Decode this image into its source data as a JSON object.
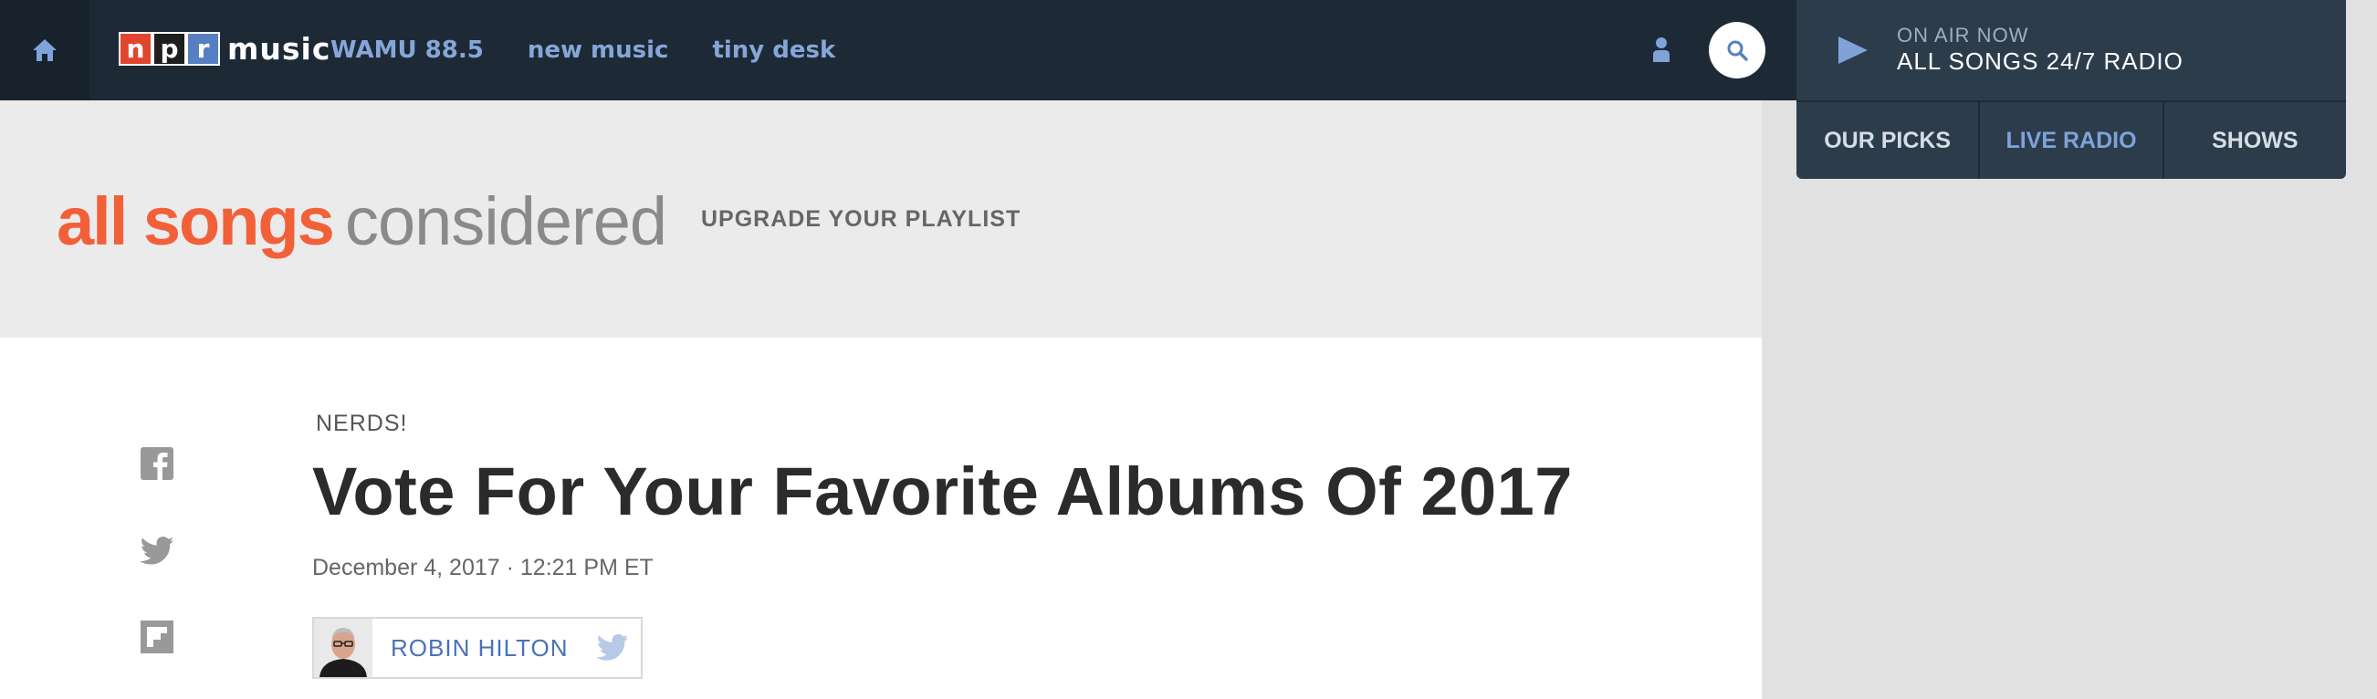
{
  "topnav": {
    "brand": {
      "n": "n",
      "p": "p",
      "r": "r",
      "music": "music"
    },
    "links": [
      "WAMU 88.5",
      "new music",
      "tiny desk"
    ]
  },
  "player": {
    "on_air_label": "ON AIR NOW",
    "station": "ALL SONGS 24/7 RADIO",
    "tabs": [
      "OUR PICKS",
      "LIVE RADIO",
      "SHOWS"
    ],
    "active_tab": "LIVE RADIO"
  },
  "banner": {
    "title_bold": "all songs",
    "title_light": "considered",
    "tagline": "UPGRADE YOUR PLAYLIST"
  },
  "article": {
    "slug": "NERDS!",
    "headline": "Vote For Your Favorite Albums Of 2017",
    "dateline": "December 4, 2017 · 12:21 PM ET",
    "author": "ROBIN HILTON"
  },
  "colors": {
    "nav_bg": "#1d2a36",
    "player_bg": "#2c3c4b",
    "link_blue": "#86a6d9",
    "brand_orange": "#f2603a"
  }
}
